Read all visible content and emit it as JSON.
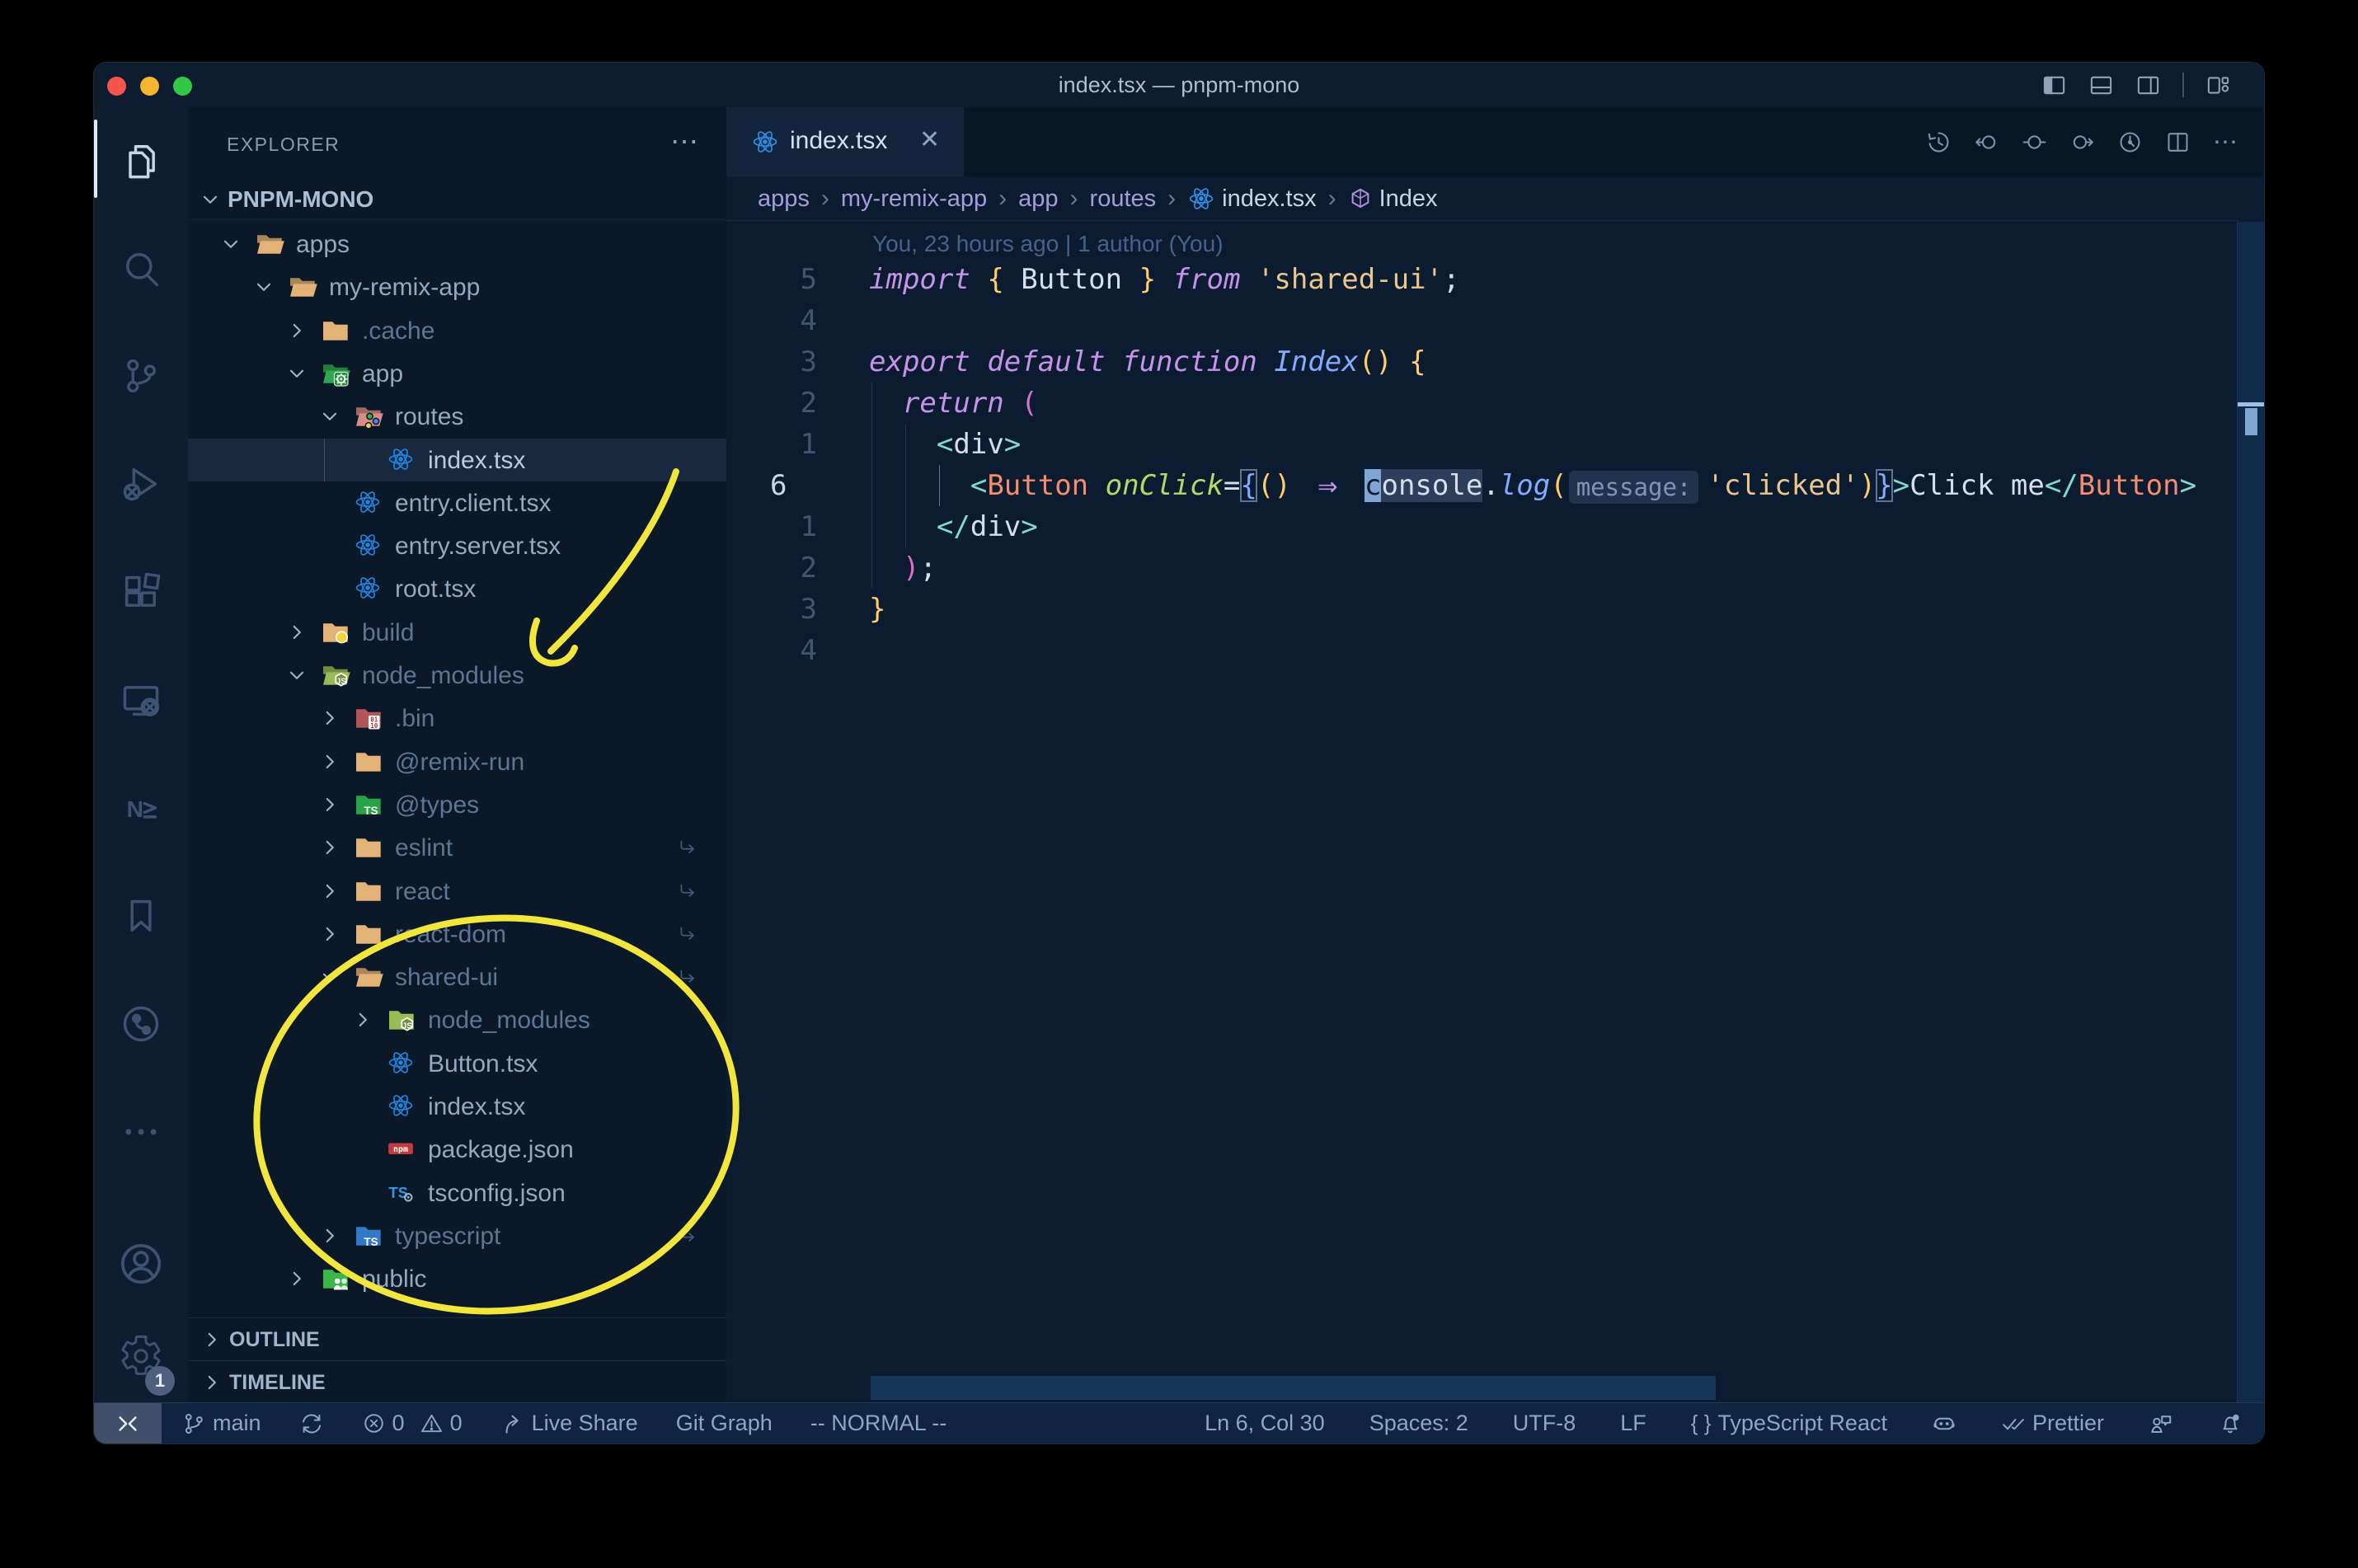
{
  "window": {
    "title": "index.tsx — pnpm-mono"
  },
  "palette": {
    "annotation_yellow": "#F2E63C",
    "react_blue": "#1E84E0",
    "folder_tan": "#E2B277",
    "accent_purple": "#C792EA",
    "status_bg": "#0F2440"
  },
  "titlebar": {
    "icons": [
      "layout-sidebar-left",
      "layout-panel",
      "layout-sidebar-right",
      "divider",
      "layout-customize"
    ]
  },
  "activity_bar": {
    "items": [
      {
        "name": "explorer",
        "active": true
      },
      {
        "name": "search"
      },
      {
        "name": "source-control"
      },
      {
        "name": "run-debug"
      },
      {
        "name": "extensions"
      },
      {
        "name": "remote-explorer"
      },
      {
        "name": "nx-console"
      },
      {
        "name": "bookmarks"
      },
      {
        "name": "git-graph"
      },
      {
        "name": "more-views"
      }
    ],
    "bottom": [
      {
        "name": "account"
      },
      {
        "name": "settings",
        "badge": "1"
      }
    ]
  },
  "sidebar": {
    "header": {
      "title": "EXPLORER",
      "more": "⋯"
    },
    "project": {
      "label": "PNPM-MONO"
    },
    "tree": [
      {
        "label": "apps",
        "depth": 0,
        "icon": "folder-tan",
        "state": "open"
      },
      {
        "label": "my-remix-app",
        "depth": 1,
        "icon": "folder-tan",
        "state": "open"
      },
      {
        "label": ".cache",
        "depth": 2,
        "icon": "folder-tan",
        "state": "closed",
        "dim": true
      },
      {
        "label": "app",
        "depth": 2,
        "icon": "folder-app",
        "state": "open"
      },
      {
        "label": "routes",
        "depth": 3,
        "icon": "folder-routes",
        "state": "open"
      },
      {
        "label": "index.tsx",
        "depth": 4,
        "icon": "react",
        "state": "file",
        "selected": true
      },
      {
        "label": "entry.client.tsx",
        "depth": 3,
        "icon": "react",
        "state": "file"
      },
      {
        "label": "entry.server.tsx",
        "depth": 3,
        "icon": "react",
        "state": "file"
      },
      {
        "label": "root.tsx",
        "depth": 3,
        "icon": "react",
        "state": "file"
      },
      {
        "label": "build",
        "depth": 2,
        "icon": "folder-build",
        "state": "closed",
        "dim": true
      },
      {
        "label": "node_modules",
        "depth": 2,
        "icon": "folder-nm",
        "state": "open",
        "dim": true
      },
      {
        "label": ".bin",
        "depth": 3,
        "icon": "folder-bin",
        "state": "closed",
        "dim": true
      },
      {
        "label": "@remix-run",
        "depth": 3,
        "icon": "folder-tan",
        "state": "closed",
        "dim": true
      },
      {
        "label": "@types",
        "depth": 3,
        "icon": "folder-types",
        "state": "closed",
        "dim": true
      },
      {
        "label": "eslint",
        "depth": 3,
        "icon": "folder-tan",
        "state": "closed",
        "dim": true,
        "symlink": true
      },
      {
        "label": "react",
        "depth": 3,
        "icon": "folder-tan",
        "state": "closed",
        "dim": true,
        "symlink": true
      },
      {
        "label": "react-dom",
        "depth": 3,
        "icon": "folder-tan",
        "state": "closed",
        "dim": true,
        "symlink": true
      },
      {
        "label": "shared-ui",
        "depth": 3,
        "icon": "folder-tan",
        "state": "open",
        "dim": true,
        "symlink": true
      },
      {
        "label": "node_modules",
        "depth": 4,
        "icon": "folder-nm",
        "state": "closed",
        "dim": true
      },
      {
        "label": "Button.tsx",
        "depth": 4,
        "icon": "react",
        "state": "file"
      },
      {
        "label": "index.tsx",
        "depth": 4,
        "icon": "react",
        "state": "file"
      },
      {
        "label": "package.json",
        "depth": 4,
        "icon": "npm",
        "state": "file"
      },
      {
        "label": "tsconfig.json",
        "depth": 4,
        "icon": "tsconfig",
        "state": "file"
      },
      {
        "label": "typescript",
        "depth": 3,
        "icon": "folder-ts",
        "state": "closed",
        "dim": true,
        "symlink": true
      },
      {
        "label": "public",
        "depth": 2,
        "icon": "folder-public",
        "state": "closed"
      }
    ],
    "sections": [
      {
        "label": "OUTLINE"
      },
      {
        "label": "TIMELINE"
      }
    ]
  },
  "editor": {
    "tab": {
      "label": "index.tsx",
      "icon": "react",
      "close": "✕"
    },
    "actions": [
      "timeline",
      "nav-back",
      "nav-circle",
      "nav-forward",
      "run-circle",
      "split-editor",
      "ellipsis"
    ],
    "breadcrumbs": [
      {
        "label": "apps"
      },
      {
        "label": "my-remix-app"
      },
      {
        "label": "app"
      },
      {
        "label": "routes"
      },
      {
        "label": "index.tsx",
        "icon": "react",
        "file": true
      },
      {
        "label": "Index",
        "icon": "symbol-module",
        "file": true
      }
    ],
    "blame": "You, 23 hours ago | 1 author (You)",
    "inlay_hint": "message:",
    "code_lines": [
      {
        "g": "5",
        "ind": 0,
        "tok": [
          [
            "import",
            "k"
          ],
          [
            " ",
            "w"
          ],
          [
            "{",
            "y"
          ],
          [
            " Button ",
            "w"
          ],
          [
            "}",
            "y"
          ],
          [
            " ",
            "w"
          ],
          [
            "from",
            "k"
          ],
          [
            " ",
            "w"
          ],
          [
            "'shared-ui'",
            "s"
          ],
          [
            ";",
            "w"
          ]
        ]
      },
      {
        "g": "4",
        "ind": 0,
        "tok": []
      },
      {
        "g": "3",
        "ind": 0,
        "tok": [
          [
            "export",
            "k"
          ],
          [
            " ",
            "w"
          ],
          [
            "default",
            "k"
          ],
          [
            " ",
            "w"
          ],
          [
            "function",
            "k"
          ],
          [
            " ",
            "w"
          ],
          [
            "Index",
            "f"
          ],
          [
            "(",
            "y"
          ],
          [
            ")",
            "y"
          ],
          [
            " ",
            "w"
          ],
          [
            "{",
            "y"
          ]
        ]
      },
      {
        "g": "2",
        "ind": 2,
        "tok": [
          [
            "return",
            "k"
          ],
          [
            " ",
            "w"
          ],
          [
            "(",
            "p"
          ]
        ]
      },
      {
        "g": "1",
        "ind": 4,
        "tok": [
          [
            "<",
            "t"
          ],
          [
            "div",
            "w"
          ],
          [
            ">",
            "t"
          ]
        ]
      },
      {
        "g": "6",
        "cur": true,
        "ind": 6,
        "tok": [
          [
            "<",
            "t"
          ],
          [
            "Button",
            "c"
          ],
          [
            " ",
            "w"
          ],
          [
            "onClick",
            "a"
          ],
          [
            "=",
            "w"
          ],
          [
            "{",
            "b box"
          ],
          [
            "(",
            "y"
          ],
          [
            ")",
            "y"
          ],
          [
            " ",
            "w"
          ],
          [
            "⇒",
            "arrow2"
          ],
          [
            " ",
            "w"
          ],
          [
            "c",
            "w cursor"
          ],
          [
            "onsole",
            "w occ"
          ],
          [
            ".",
            "w"
          ],
          [
            "log",
            "f"
          ],
          [
            "(",
            "y"
          ],
          [
            "message:",
            "inlay"
          ],
          [
            "'clicked'",
            "s"
          ],
          [
            ")",
            "y"
          ],
          [
            "}",
            "b box"
          ],
          [
            ">",
            "t"
          ],
          [
            "Click me",
            "w"
          ],
          [
            "</",
            "t"
          ],
          [
            "Button",
            "c"
          ],
          [
            ">",
            "t"
          ]
        ]
      },
      {
        "g": "1",
        "ind": 4,
        "tok": [
          [
            "</",
            "t"
          ],
          [
            "div",
            "w"
          ],
          [
            ">",
            "t"
          ]
        ]
      },
      {
        "g": "2",
        "ind": 2,
        "tok": [
          [
            ")",
            "p"
          ],
          [
            ";",
            "w"
          ]
        ]
      },
      {
        "g": "3",
        "ind": 0,
        "tok": [
          [
            "}",
            "y"
          ]
        ]
      },
      {
        "g": "4",
        "ind": 0,
        "tok": []
      }
    ]
  },
  "status_bar": {
    "left": [
      {
        "icon": "remote",
        "chip": true,
        "name": "remote"
      },
      {
        "icon": "branch",
        "label": "main",
        "name": "branch"
      },
      {
        "icon": "sync",
        "name": "sync"
      },
      {
        "icon": "error",
        "label": "0",
        "icon2": "warning",
        "label2": "0",
        "name": "problems"
      },
      {
        "icon": "liveshare",
        "label": "Live Share",
        "name": "live-share"
      },
      {
        "label": "Git Graph",
        "name": "git-graph"
      },
      {
        "label": "-- NORMAL --",
        "name": "vim-mode"
      }
    ],
    "right": [
      {
        "label": "Ln 6, Col 30",
        "name": "cursor-position"
      },
      {
        "label": "Spaces: 2",
        "name": "indentation"
      },
      {
        "label": "UTF-8",
        "name": "encoding"
      },
      {
        "label": "LF",
        "name": "eol"
      },
      {
        "icon": "braces",
        "label": "TypeScript React",
        "name": "language-mode"
      },
      {
        "icon": "copilot",
        "name": "copilot"
      },
      {
        "icon": "checks",
        "label": "Prettier",
        "name": "prettier"
      },
      {
        "icon": "feedback",
        "name": "feedback"
      },
      {
        "icon": "bell-dot",
        "name": "notifications"
      }
    ]
  },
  "annotations": {
    "color": "#F2E63C"
  }
}
